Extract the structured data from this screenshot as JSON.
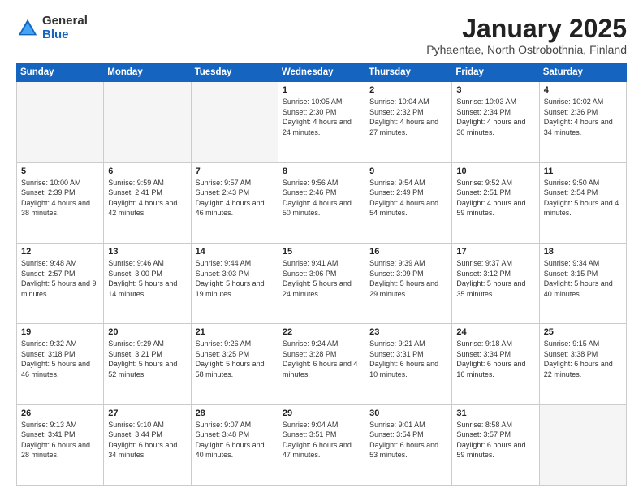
{
  "header": {
    "logo_general": "General",
    "logo_blue": "Blue",
    "month": "January 2025",
    "location": "Pyhaentae, North Ostrobothnia, Finland"
  },
  "days_of_week": [
    "Sunday",
    "Monday",
    "Tuesday",
    "Wednesday",
    "Thursday",
    "Friday",
    "Saturday"
  ],
  "weeks": [
    [
      {
        "day": "",
        "info": ""
      },
      {
        "day": "",
        "info": ""
      },
      {
        "day": "",
        "info": ""
      },
      {
        "day": "1",
        "info": "Sunrise: 10:05 AM\nSunset: 2:30 PM\nDaylight: 4 hours and 24 minutes."
      },
      {
        "day": "2",
        "info": "Sunrise: 10:04 AM\nSunset: 2:32 PM\nDaylight: 4 hours and 27 minutes."
      },
      {
        "day": "3",
        "info": "Sunrise: 10:03 AM\nSunset: 2:34 PM\nDaylight: 4 hours and 30 minutes."
      },
      {
        "day": "4",
        "info": "Sunrise: 10:02 AM\nSunset: 2:36 PM\nDaylight: 4 hours and 34 minutes."
      }
    ],
    [
      {
        "day": "5",
        "info": "Sunrise: 10:00 AM\nSunset: 2:39 PM\nDaylight: 4 hours and 38 minutes."
      },
      {
        "day": "6",
        "info": "Sunrise: 9:59 AM\nSunset: 2:41 PM\nDaylight: 4 hours and 42 minutes."
      },
      {
        "day": "7",
        "info": "Sunrise: 9:57 AM\nSunset: 2:43 PM\nDaylight: 4 hours and 46 minutes."
      },
      {
        "day": "8",
        "info": "Sunrise: 9:56 AM\nSunset: 2:46 PM\nDaylight: 4 hours and 50 minutes."
      },
      {
        "day": "9",
        "info": "Sunrise: 9:54 AM\nSunset: 2:49 PM\nDaylight: 4 hours and 54 minutes."
      },
      {
        "day": "10",
        "info": "Sunrise: 9:52 AM\nSunset: 2:51 PM\nDaylight: 4 hours and 59 minutes."
      },
      {
        "day": "11",
        "info": "Sunrise: 9:50 AM\nSunset: 2:54 PM\nDaylight: 5 hours and 4 minutes."
      }
    ],
    [
      {
        "day": "12",
        "info": "Sunrise: 9:48 AM\nSunset: 2:57 PM\nDaylight: 5 hours and 9 minutes."
      },
      {
        "day": "13",
        "info": "Sunrise: 9:46 AM\nSunset: 3:00 PM\nDaylight: 5 hours and 14 minutes."
      },
      {
        "day": "14",
        "info": "Sunrise: 9:44 AM\nSunset: 3:03 PM\nDaylight: 5 hours and 19 minutes."
      },
      {
        "day": "15",
        "info": "Sunrise: 9:41 AM\nSunset: 3:06 PM\nDaylight: 5 hours and 24 minutes."
      },
      {
        "day": "16",
        "info": "Sunrise: 9:39 AM\nSunset: 3:09 PM\nDaylight: 5 hours and 29 minutes."
      },
      {
        "day": "17",
        "info": "Sunrise: 9:37 AM\nSunset: 3:12 PM\nDaylight: 5 hours and 35 minutes."
      },
      {
        "day": "18",
        "info": "Sunrise: 9:34 AM\nSunset: 3:15 PM\nDaylight: 5 hours and 40 minutes."
      }
    ],
    [
      {
        "day": "19",
        "info": "Sunrise: 9:32 AM\nSunset: 3:18 PM\nDaylight: 5 hours and 46 minutes."
      },
      {
        "day": "20",
        "info": "Sunrise: 9:29 AM\nSunset: 3:21 PM\nDaylight: 5 hours and 52 minutes."
      },
      {
        "day": "21",
        "info": "Sunrise: 9:26 AM\nSunset: 3:25 PM\nDaylight: 5 hours and 58 minutes."
      },
      {
        "day": "22",
        "info": "Sunrise: 9:24 AM\nSunset: 3:28 PM\nDaylight: 6 hours and 4 minutes."
      },
      {
        "day": "23",
        "info": "Sunrise: 9:21 AM\nSunset: 3:31 PM\nDaylight: 6 hours and 10 minutes."
      },
      {
        "day": "24",
        "info": "Sunrise: 9:18 AM\nSunset: 3:34 PM\nDaylight: 6 hours and 16 minutes."
      },
      {
        "day": "25",
        "info": "Sunrise: 9:15 AM\nSunset: 3:38 PM\nDaylight: 6 hours and 22 minutes."
      }
    ],
    [
      {
        "day": "26",
        "info": "Sunrise: 9:13 AM\nSunset: 3:41 PM\nDaylight: 6 hours and 28 minutes."
      },
      {
        "day": "27",
        "info": "Sunrise: 9:10 AM\nSunset: 3:44 PM\nDaylight: 6 hours and 34 minutes."
      },
      {
        "day": "28",
        "info": "Sunrise: 9:07 AM\nSunset: 3:48 PM\nDaylight: 6 hours and 40 minutes."
      },
      {
        "day": "29",
        "info": "Sunrise: 9:04 AM\nSunset: 3:51 PM\nDaylight: 6 hours and 47 minutes."
      },
      {
        "day": "30",
        "info": "Sunrise: 9:01 AM\nSunset: 3:54 PM\nDaylight: 6 hours and 53 minutes."
      },
      {
        "day": "31",
        "info": "Sunrise: 8:58 AM\nSunset: 3:57 PM\nDaylight: 6 hours and 59 minutes."
      },
      {
        "day": "",
        "info": ""
      }
    ]
  ]
}
